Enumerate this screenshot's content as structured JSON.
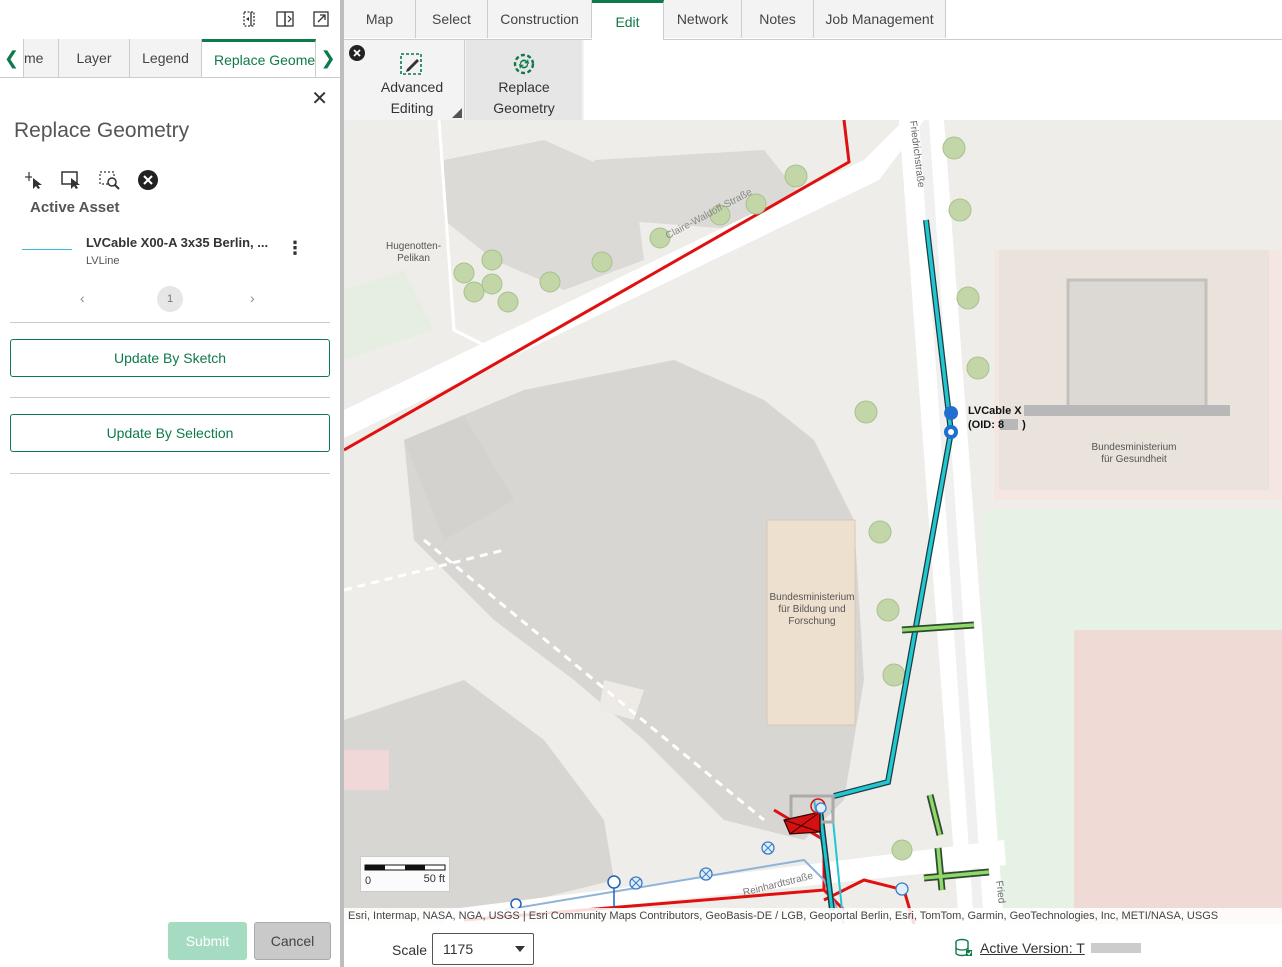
{
  "left_panel": {
    "tabs": [
      {
        "label": "me"
      },
      {
        "label": "Layer"
      },
      {
        "label": "Legend"
      },
      {
        "label": "Replace Geomet"
      }
    ],
    "title": "Replace Geometry",
    "active_asset_heading": "Active Asset",
    "asset": {
      "name": "LVCable X00-A 3x35 Berlin, ...",
      "type": "LVLine"
    },
    "pager": {
      "prev": "‹",
      "current": "1",
      "next": "›"
    },
    "update_by_sketch": "Update By Sketch",
    "update_by_selection": "Update By Selection",
    "submit": "Submit",
    "cancel": "Cancel"
  },
  "ribbon": {
    "tabs": [
      {
        "label": "Map"
      },
      {
        "label": "Select"
      },
      {
        "label": "Construction"
      },
      {
        "label": "Edit"
      },
      {
        "label": "Network"
      },
      {
        "label": "Notes"
      },
      {
        "label": "Job Management"
      }
    ],
    "advanced_editing": [
      "Advanced",
      "Editing"
    ],
    "replace_geometry": [
      "Replace",
      "Geometry"
    ]
  },
  "map": {
    "labels": {
      "hugenotten": [
        "Hugenotten-",
        "Pelikan"
      ],
      "claire_waldoff": "Claire-Waldoff-Straße",
      "friedrichstrasse": "Friedrichstraße",
      "friedrichstrasse_2": "Fried",
      "reinhardtstrasse": "Reinhardtstraße",
      "bmg": [
        "Bundesministerium",
        "für Gesundheit"
      ],
      "bmbf": [
        "Bundesministerium",
        "für Bildung und",
        "Forschung"
      ],
      "popup": [
        "LVCable X",
        "(OID: 8",
        ")"
      ]
    },
    "scalebar": {
      "zero": "0",
      "max": "50 ft"
    },
    "attribution": "Esri, Intermap, NASA, NGA, USGS | Esri Community Maps Contributors, GeoBasis-DE / LGB, Geoportal Berlin, Esri, TomTom, Garmin, GeoTechnologies, Inc, METI/NASA, USGS"
  },
  "status": {
    "scale_label": "Scale",
    "scale_value": "1175",
    "active_version": "Active Version: T"
  },
  "colors": {
    "accent": "#0d7a4a",
    "cable": "#22c6d0",
    "boundary": "#e01010"
  }
}
